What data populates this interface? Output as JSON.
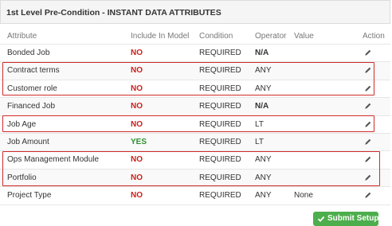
{
  "panel": {
    "title": "1st Level Pre-Condition - INSTANT DATA ATTRIBUTES"
  },
  "columns": {
    "attribute": "Attribute",
    "include": "Include In Model",
    "condition": "Condition",
    "operator": "Operator",
    "value": "Value",
    "action": "Action"
  },
  "rows": [
    {
      "attribute": "Bonded Job",
      "include": "NO",
      "condition": "REQUIRED",
      "operator": "N/A",
      "value": ""
    },
    {
      "attribute": "Contract terms",
      "include": "NO",
      "condition": "REQUIRED",
      "operator": "ANY",
      "value": ""
    },
    {
      "attribute": "Customer role",
      "include": "NO",
      "condition": "REQUIRED",
      "operator": "ANY",
      "value": ""
    },
    {
      "attribute": "Financed Job",
      "include": "NO",
      "condition": "REQUIRED",
      "operator": "N/A",
      "value": ""
    },
    {
      "attribute": "Job Age",
      "include": "NO",
      "condition": "REQUIRED",
      "operator": "LT",
      "value": ""
    },
    {
      "attribute": "Job Amount",
      "include": "YES",
      "condition": "REQUIRED",
      "operator": "LT",
      "value": ""
    },
    {
      "attribute": "Ops Management Module",
      "include": "NO",
      "condition": "REQUIRED",
      "operator": "ANY",
      "value": ""
    },
    {
      "attribute": "Portfolio",
      "include": "NO",
      "condition": "REQUIRED",
      "operator": "ANY",
      "value": ""
    },
    {
      "attribute": "Project Type",
      "include": "NO",
      "condition": "REQUIRED",
      "operator": "ANY",
      "value": "None"
    }
  ],
  "icons": {
    "edit": "pencil-icon",
    "submit": "check-icon"
  },
  "colors": {
    "no": "#cc1f1a",
    "yes": "#2f8f2f",
    "highlight": "#d12b2b",
    "submit": "#4cae4c"
  },
  "submit": {
    "label": "Submit Setup"
  }
}
